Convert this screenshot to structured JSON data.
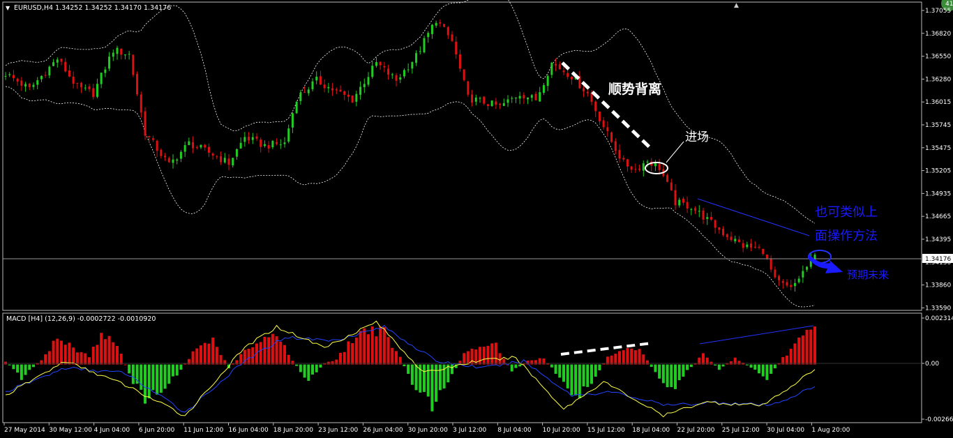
{
  "window": {
    "symbol_header": "EURUSD,H4  1.34252 1.34252 1.34170 1.34176",
    "corner_badge": "41"
  },
  "price_axis": {
    "labels": [
      "1.37055",
      "1.36820",
      "1.36550",
      "1.36280",
      "1.36015",
      "1.35745",
      "1.35475",
      "1.35205",
      "1.34935",
      "1.34665",
      "1.34395",
      "1.34130",
      "1.33860",
      "1.33590"
    ],
    "current_price": "1.34176"
  },
  "macd": {
    "header": "MACD [H4] (12,26,9) -0.0002722 -0.0010920",
    "axis_labels": [
      "0.0023144",
      "0.00",
      "-0.002669"
    ]
  },
  "time_axis": {
    "labels": [
      "27 May 2014",
      "30 May 12:00",
      "4 Jun 04:00",
      "6 Jun 20:00",
      "11 Jun 12:00",
      "16 Jun 04:00",
      "18 Jun 20:00",
      "23 Jun 12:00",
      "26 Jun 04:00",
      "30 Jun 20:00",
      "3 Jul 12:00",
      "8 Jul 04:00",
      "10 Jul 20:00",
      "15 Jul 12:00",
      "18 Jul 04:00",
      "22 Jul 20:00",
      "25 Jul 12:00",
      "30 Jul 04:00",
      "1 Aug 20:00"
    ]
  },
  "annotations": {
    "trend_divergence": "顺势背离",
    "entry": "进场",
    "similar_line1": "也可类似上",
    "similar_line2": "面操作方法",
    "expected_future": "预期未来"
  },
  "colors": {
    "background": "#000000",
    "bull_candle": "#22cc22",
    "bear_candle": "#dd1111",
    "bollinger": "#ffffff",
    "macd_signal": "#2244ff",
    "macd_main": "#ffff44",
    "annotation_blue": "#1a1aff"
  },
  "chart_data": {
    "type": "candlestick",
    "symbol": "EURUSD",
    "timeframe": "H4",
    "last_bar": {
      "open": 1.34252,
      "high": 1.34252,
      "low": 1.3417,
      "close": 1.34176
    },
    "price_range": [
      1.3356,
      1.371
    ],
    "close_path": [
      [
        0,
        1.3628
      ],
      [
        6,
        1.361
      ],
      [
        13,
        1.3645
      ],
      [
        18,
        1.3612
      ],
      [
        22,
        1.3605
      ],
      [
        27,
        1.3655
      ],
      [
        31,
        1.365
      ],
      [
        35,
        1.356
      ],
      [
        41,
        1.3523
      ],
      [
        46,
        1.3548
      ],
      [
        52,
        1.3535
      ],
      [
        56,
        1.3525
      ],
      [
        60,
        1.3555
      ],
      [
        65,
        1.3545
      ],
      [
        70,
        1.3548
      ],
      [
        73,
        1.36
      ],
      [
        78,
        1.362
      ],
      [
        83,
        1.3607
      ],
      [
        87,
        1.3598
      ],
      [
        93,
        1.364
      ],
      [
        98,
        1.362
      ],
      [
        103,
        1.3648
      ],
      [
        108,
        1.369
      ],
      [
        112,
        1.3665
      ],
      [
        116,
        1.36
      ],
      [
        120,
        1.3595
      ],
      [
        124,
        1.359
      ],
      [
        129,
        1.3605
      ],
      [
        133,
        1.3598
      ],
      [
        137,
        1.364
      ],
      [
        142,
        1.3625
      ],
      [
        146,
        1.3605
      ],
      [
        151,
        1.3558
      ],
      [
        155,
        1.3525
      ],
      [
        158,
        1.3518
      ],
      [
        161,
        1.3528
      ],
      [
        164,
        1.352
      ],
      [
        168,
        1.348
      ],
      [
        172,
        1.3475
      ],
      [
        176,
        1.346
      ],
      [
        180,
        1.3445
      ],
      [
        185,
        1.343
      ],
      [
        190,
        1.3425
      ],
      [
        193,
        1.339
      ],
      [
        197,
        1.338
      ],
      [
        200,
        1.34
      ],
      [
        203,
        1.3418
      ]
    ],
    "macd_histogram_path": [
      [
        0,
        0.0002
      ],
      [
        4,
        -0.0008
      ],
      [
        9,
        0.0003
      ],
      [
        13,
        0.0016
      ],
      [
        17,
        0.001
      ],
      [
        21,
        0.0005
      ],
      [
        24,
        0.0018
      ],
      [
        28,
        0.0012
      ],
      [
        31,
        -0.0006
      ],
      [
        35,
        -0.0022
      ],
      [
        39,
        -0.0015
      ],
      [
        43,
        -0.0006
      ],
      [
        48,
        0.001
      ],
      [
        52,
        0.0015
      ],
      [
        56,
        -0.0002
      ],
      [
        60,
        0.0008
      ],
      [
        64,
        0.0013
      ],
      [
        68,
        0.002
      ],
      [
        72,
        0.0002
      ],
      [
        76,
        -0.001
      ],
      [
        80,
        0.0001
      ],
      [
        83,
        0.0003
      ],
      [
        87,
        0.0015
      ],
      [
        91,
        0.0022
      ],
      [
        95,
        0.0019
      ],
      [
        99,
        0.0004
      ],
      [
        103,
        -0.0016
      ],
      [
        107,
        -0.0024
      ],
      [
        111,
        -0.001
      ],
      [
        115,
        0.0006
      ],
      [
        119,
        0.0011
      ],
      [
        123,
        0.0012
      ],
      [
        127,
        -0.0004
      ],
      [
        131,
        0.0002
      ],
      [
        135,
        0.0004
      ],
      [
        139,
        -0.0008
      ],
      [
        143,
        -0.002
      ],
      [
        147,
        -0.001
      ],
      [
        151,
        0.0004
      ],
      [
        155,
        0.0008
      ],
      [
        159,
        0.001
      ],
      [
        163,
        -0.0005
      ],
      [
        167,
        -0.0016
      ],
      [
        171,
        -0.0004
      ],
      [
        175,
        0.0006
      ],
      [
        179,
        -0.0003
      ],
      [
        183,
        0.0004
      ],
      [
        187,
        -0.0002
      ],
      [
        191,
        -0.0008
      ],
      [
        195,
        0.0004
      ],
      [
        199,
        0.0014
      ],
      [
        203,
        0.0022
      ]
    ],
    "macd_main_path": [
      [
        0,
        -0.0018
      ],
      [
        15,
        0.0002
      ],
      [
        30,
        -0.0012
      ],
      [
        45,
        -0.003
      ],
      [
        60,
        0.001
      ],
      [
        68,
        0.0022
      ],
      [
        80,
        0.001
      ],
      [
        93,
        0.0025
      ],
      [
        105,
        -0.0005
      ],
      [
        118,
        0.0002
      ],
      [
        128,
        0.0004
      ],
      [
        140,
        -0.0026
      ],
      [
        150,
        -0.001
      ],
      [
        165,
        -0.003
      ],
      [
        175,
        -0.0022
      ],
      [
        190,
        -0.0024
      ],
      [
        203,
        -0.0003
      ]
    ],
    "macd_signal_path": [
      [
        0,
        -0.0016
      ],
      [
        15,
        -0.0002
      ],
      [
        30,
        -0.0005
      ],
      [
        45,
        -0.0028
      ],
      [
        60,
        0.0002
      ],
      [
        70,
        0.0016
      ],
      [
        82,
        0.0014
      ],
      [
        95,
        0.0022
      ],
      [
        108,
        0.0002
      ],
      [
        120,
        -0.0002
      ],
      [
        130,
        0.0002
      ],
      [
        142,
        -0.0018
      ],
      [
        152,
        -0.0016
      ],
      [
        166,
        -0.0024
      ],
      [
        178,
        -0.0022
      ],
      [
        192,
        -0.0024
      ],
      [
        203,
        -0.0013
      ]
    ]
  }
}
